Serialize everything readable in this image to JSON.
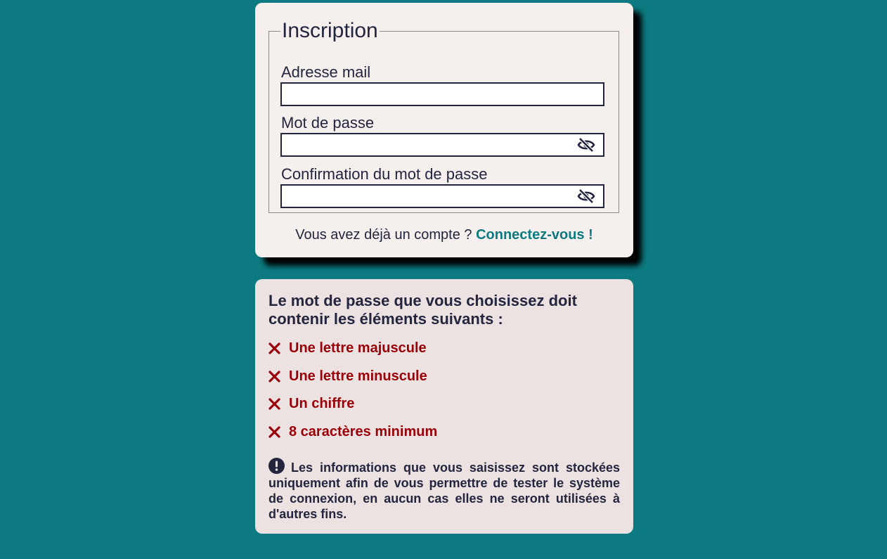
{
  "signup": {
    "legend": "Inscription",
    "email_label": "Adresse mail",
    "email_value": "",
    "password_label": "Mot de passe",
    "password_value": "",
    "confirm_label": "Confirmation du mot de passe",
    "confirm_value": "",
    "toggle_icon": "eye-slash-icon",
    "login_prompt": "Vous avez déjà un compte ?",
    "login_link": "Connectez-vous !"
  },
  "requirements": {
    "title": "Le mot de passe que vous choisissez doit contenir les éléments suivants :",
    "status_icon": "x-mark-icon",
    "items": [
      {
        "label": "Une lettre majuscule",
        "met": false
      },
      {
        "label": "Une lettre minuscule",
        "met": false
      },
      {
        "label": "Un chiffre",
        "met": false
      },
      {
        "label": "8 caractères minimum",
        "met": false
      }
    ],
    "notice_icon": "exclamation-circle-icon",
    "notice": "Les informations que vous saisissez sont stockées uniquement afin de vous permettre de tester le système de connexion, en aucun cas elles ne seront utilisées à d'autres fins."
  },
  "colors": {
    "background": "#0c7a80",
    "card": "#f5f0ee",
    "rules_card": "#ede2e2",
    "text": "#23253f",
    "link": "#0c7a80",
    "error": "#9a0007"
  }
}
